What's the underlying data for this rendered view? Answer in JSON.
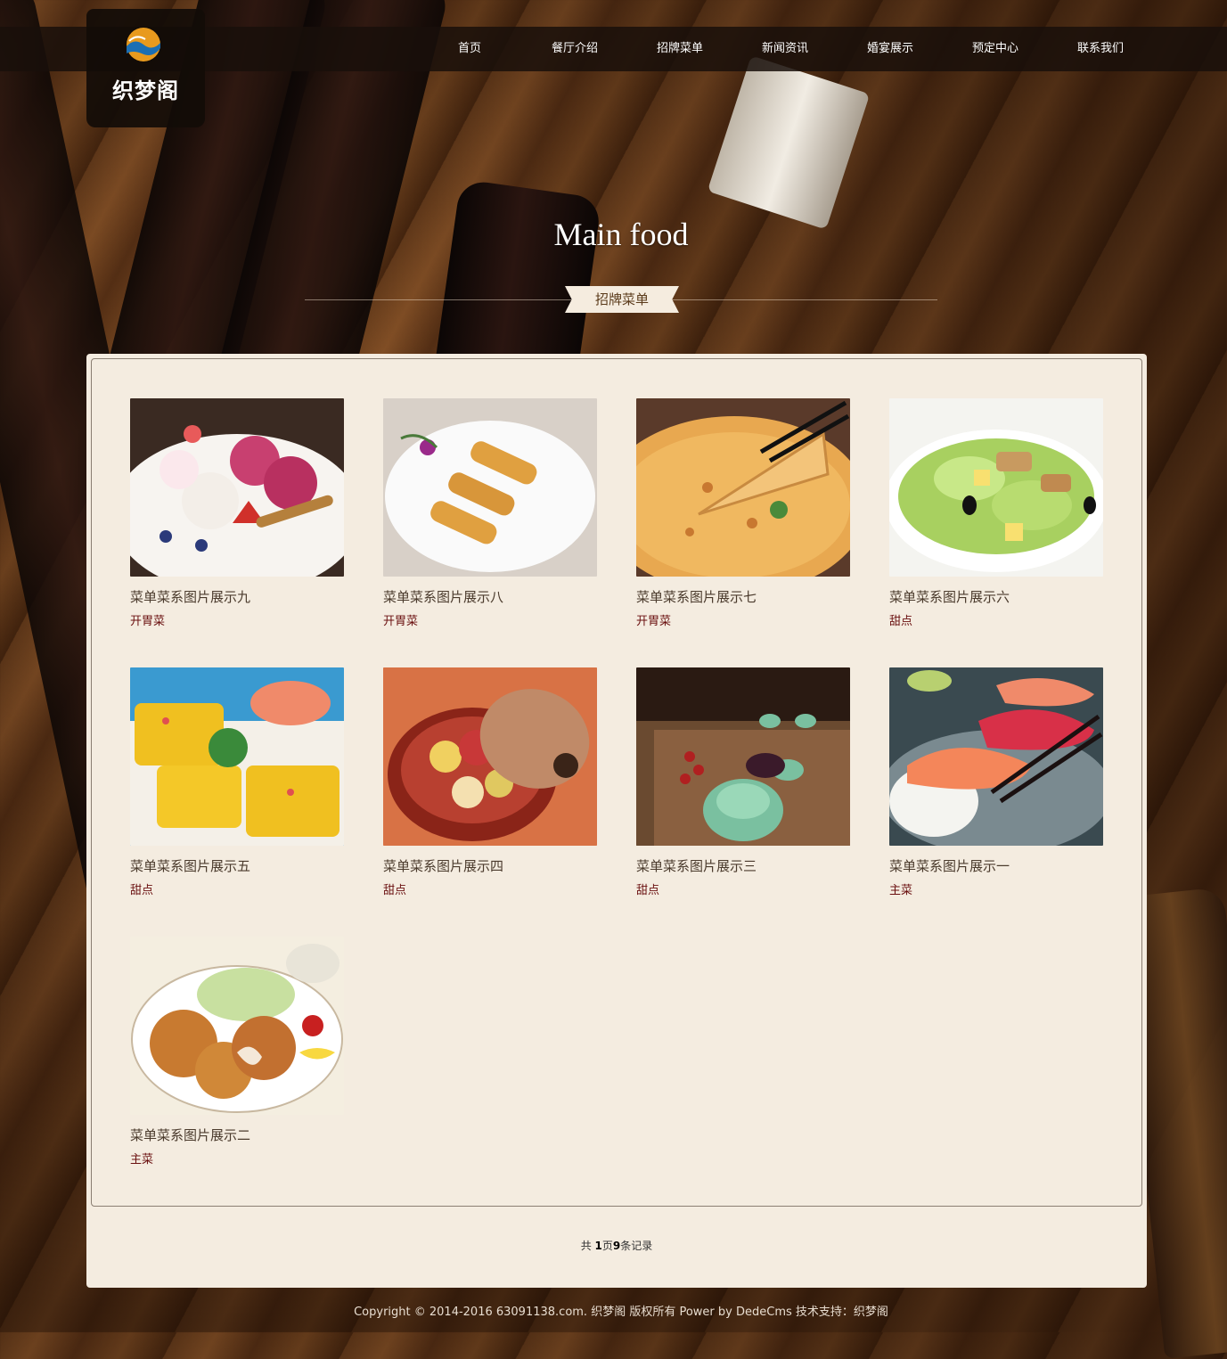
{
  "logo": {
    "text": "织梦阁"
  },
  "nav": {
    "items": [
      {
        "label": "首页"
      },
      {
        "label": "餐厅介绍"
      },
      {
        "label": "招牌菜单"
      },
      {
        "label": "新闻资讯"
      },
      {
        "label": "婚宴展示"
      },
      {
        "label": "预定中心"
      },
      {
        "label": "联系我们"
      }
    ]
  },
  "banner": {
    "title": "Main food",
    "section_label": "招牌菜单"
  },
  "items": [
    {
      "title": "菜单菜系图片展示九",
      "category": "开胃菜",
      "image": "ice-cream-dessert"
    },
    {
      "title": "菜单菜系图片展示八",
      "category": "开胃菜",
      "image": "spring-rolls"
    },
    {
      "title": "菜单菜系图片展示七",
      "category": "开胃菜",
      "image": "pizza"
    },
    {
      "title": "菜单菜系图片展示六",
      "category": "甜点",
      "image": "salad"
    },
    {
      "title": "菜单菜系图片展示五",
      "category": "甜点",
      "image": "corn-cakes"
    },
    {
      "title": "菜单菜系图片展示四",
      "category": "甜点",
      "image": "pastry-bowl"
    },
    {
      "title": "菜单菜系图片展示三",
      "category": "甜点",
      "image": "tea-set"
    },
    {
      "title": "菜单菜系图片展示一",
      "category": "主菜",
      "image": "sushi"
    },
    {
      "title": "菜单菜系图片展示二",
      "category": "主菜",
      "image": "fried-cutlets"
    }
  ],
  "pager": {
    "prefix": "共 ",
    "pages": "1",
    "mid": "页",
    "records": "9",
    "suffix": "条记录"
  },
  "footer": {
    "text": "Copyright © 2014-2016 63091138.com. 织梦阁 版权所有 Power by DedeCms    技术支持：织梦阁"
  },
  "colors": {
    "panel": "#f4ece0",
    "category": "#6a1010",
    "nav_bar": "#190f0a"
  }
}
